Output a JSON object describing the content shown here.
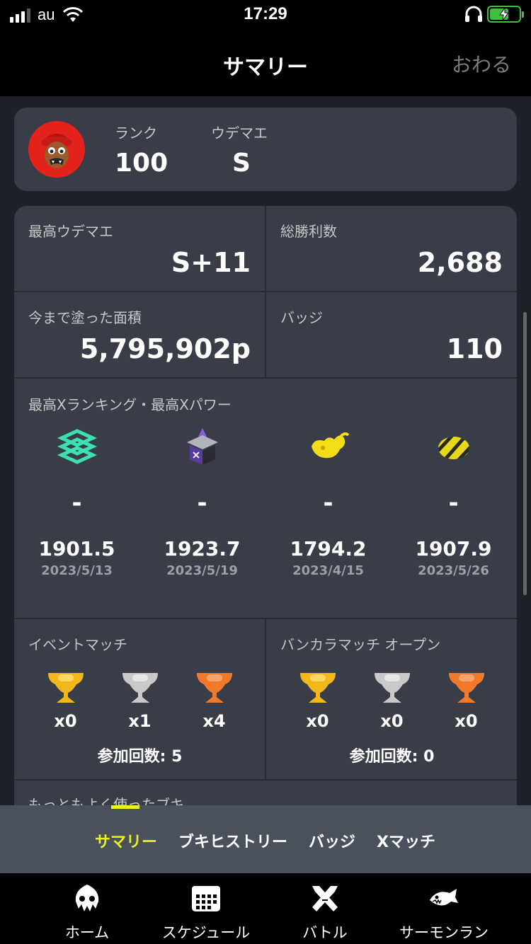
{
  "status_bar": {
    "carrier": "au",
    "time": "17:29"
  },
  "header": {
    "title": "サマリー",
    "close": "おわる"
  },
  "profile": {
    "rank_label": "ランク",
    "rank_value": "100",
    "udemae_label": "ウデマエ",
    "udemae_value": "S"
  },
  "stats": {
    "max_udemae": {
      "label": "最高ウデマエ",
      "value": "S+11"
    },
    "total_wins": {
      "label": "総勝利数",
      "value": "2,688"
    },
    "turf_inked": {
      "label": "今まで塗った面積",
      "value": "5,795,902p"
    },
    "badges": {
      "label": "バッジ",
      "value": "110"
    }
  },
  "xranking": {
    "title": "最高Xランキング・最高Xパワー",
    "modes": [
      {
        "icon": "splat-zones-icon",
        "rank": "-",
        "power": "1901.5",
        "date": "2023/5/13"
      },
      {
        "icon": "tower-control-icon",
        "rank": "-",
        "power": "1923.7",
        "date": "2023/5/19"
      },
      {
        "icon": "rainmaker-icon",
        "rank": "-",
        "power": "1794.2",
        "date": "2023/4/15"
      },
      {
        "icon": "clam-blitz-icon",
        "rank": "-",
        "power": "1907.9",
        "date": "2023/5/26"
      }
    ]
  },
  "event_match": {
    "label": "イベントマッチ",
    "trophies": [
      {
        "medal": "gold",
        "count": "x0"
      },
      {
        "medal": "silver",
        "count": "x1"
      },
      {
        "medal": "bronze",
        "count": "x4"
      }
    ],
    "participation": "参加回数: 5"
  },
  "bankara_open": {
    "label": "バンカラマッチ オープン",
    "trophies": [
      {
        "medal": "gold",
        "count": "x0"
      },
      {
        "medal": "silver",
        "count": "x0"
      },
      {
        "medal": "bronze",
        "count": "x0"
      }
    ],
    "participation": "参加回数: 0"
  },
  "most_used": {
    "label": "もっともよく使ったブキ"
  },
  "subtabs": {
    "summary": "サマリー",
    "weapon_history": "ブキヒストリー",
    "badges": "バッジ",
    "xmatch": "Xマッチ"
  },
  "nav": {
    "home": "ホーム",
    "schedule": "スケジュール",
    "battle": "バトル",
    "salmon_run": "サーモンラン"
  },
  "colors": {
    "accent": "#e8f31d",
    "card": "#393d47",
    "background": "#1e2127",
    "gold": "#f2b81b",
    "silver": "#c9c9c9",
    "bronze": "#f07a2a"
  }
}
